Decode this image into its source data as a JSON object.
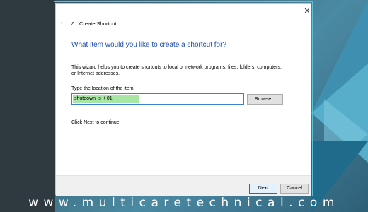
{
  "window": {
    "title": "Create Shortcut",
    "close_glyph": "✕",
    "back_glyph": "←",
    "app_glyph": "↗"
  },
  "wizard": {
    "heading": "What item would you like to create a shortcut for?",
    "description": "This wizard helps you to create shortcuts to local or network programs, files, folders, computers, or Internet addresses.",
    "location_label": "Type the location of the item:",
    "location_value": "shutdown -s -t 01",
    "browse_label": "Browse...",
    "continue_hint": "Click Next to continue."
  },
  "footer": {
    "next_label": "Next",
    "cancel_label": "Cancel"
  },
  "watermark": "www.multicaretechnical.com",
  "colors": {
    "accent": "#1e4fb3",
    "input_highlight": "#a8e6a3",
    "focus_border": "#3c7fd6"
  },
  "icons": [
    "back-arrow-icon",
    "shortcut-icon",
    "close-icon"
  ]
}
